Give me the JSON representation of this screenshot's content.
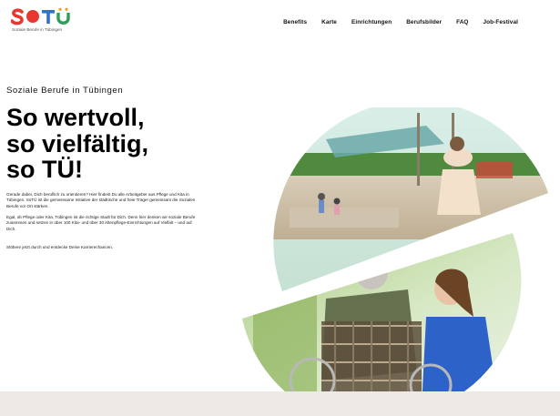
{
  "brand": {
    "name": "SOTÜ",
    "tagline": "Soziale Berufe in Tübingen",
    "colors": {
      "red": "#e8372f",
      "orange": "#f4a21d",
      "blue": "#2f6fd6",
      "green": "#2e9e5b"
    }
  },
  "nav": {
    "items": [
      {
        "label": "Benefits"
      },
      {
        "label": "Karte"
      },
      {
        "label": "Einrichtungen"
      },
      {
        "label": "Berufsbilder"
      },
      {
        "label": "FAQ"
      },
      {
        "label": "Job-Festival"
      }
    ]
  },
  "hero": {
    "eyebrow": "Soziale Berufe in Tübingen",
    "headline": [
      "So wertvoll,",
      "so vielfältig,",
      "so TÜ!"
    ],
    "paragraphs": [
      "Gerade dabei, Dich beruflich zu orientieren? Hier findest Du alle Arbeitgeber aus Pflege und Kita in Tübingen. SoTÜ ist die gemeinsame Initiative der städtische und freie Träger gemeinsam die Sozialen Berufe vor Ort stärken.",
      "Egal, ob Pflege oder Kita, Tübingen ist die richtige Stadt für Dich. Denn hier denken wir soziale Berufe zusammen und setzen in über 100 Kita- und über 30 Altenpflege-Einrichtungen auf Vielfalt – und auf Dich.",
      "Stöbere jetzt durch und entdecke Deine Karrierechancen."
    ]
  }
}
